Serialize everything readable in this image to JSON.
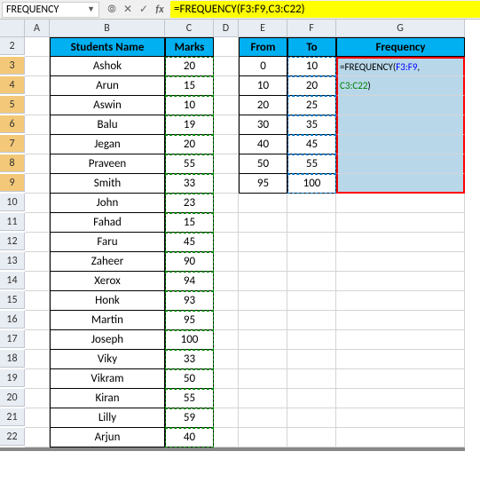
{
  "nameBox": "FREQUENCY",
  "formula": "=FREQUENCY(F3:F9,C3:C22)",
  "formulaParts": {
    "pre": "=FREQUENCY(",
    "r1": "F3:F9",
    "mid": ",",
    "r2": "C3:C22",
    "end": ")"
  },
  "cols": [
    "A",
    "B",
    "C",
    "D",
    "E",
    "F",
    "G"
  ],
  "rows": [
    "2",
    "3",
    "4",
    "5",
    "6",
    "7",
    "8",
    "9",
    "10",
    "11",
    "12",
    "13",
    "14",
    "15",
    "16",
    "17",
    "18",
    "19",
    "20",
    "21",
    "22"
  ],
  "h": {
    "b2": "Students Name",
    "c2": "Marks",
    "e2": "From",
    "f2": "To",
    "g2": "Frequency"
  },
  "students": [
    {
      "name": "Ashok",
      "marks": "20"
    },
    {
      "name": "Arun",
      "marks": "15"
    },
    {
      "name": "Aswin",
      "marks": "10"
    },
    {
      "name": "Balu",
      "marks": "19"
    },
    {
      "name": "Jegan",
      "marks": "20"
    },
    {
      "name": "Praveen",
      "marks": "55"
    },
    {
      "name": "Smith",
      "marks": "33"
    },
    {
      "name": "John",
      "marks": "23"
    },
    {
      "name": "Fahad",
      "marks": "15"
    },
    {
      "name": "Faru",
      "marks": "45"
    },
    {
      "name": "Zaheer",
      "marks": "90"
    },
    {
      "name": "Xerox",
      "marks": "94"
    },
    {
      "name": "Honk",
      "marks": "93"
    },
    {
      "name": "Martin",
      "marks": "95"
    },
    {
      "name": "Joseph",
      "marks": "100"
    },
    {
      "name": "Viky",
      "marks": "33"
    },
    {
      "name": "Vikram",
      "marks": "50"
    },
    {
      "name": "Kiran",
      "marks": "55"
    },
    {
      "name": "Lilly",
      "marks": "59"
    },
    {
      "name": "Arjun",
      "marks": "40"
    }
  ],
  "bins": [
    {
      "from": "0",
      "to": "10"
    },
    {
      "from": "10",
      "to": "20"
    },
    {
      "from": "20",
      "to": "25"
    },
    {
      "from": "30",
      "to": "35"
    },
    {
      "from": "40",
      "to": "45"
    },
    {
      "from": "50",
      "to": "55"
    },
    {
      "from": "95",
      "to": "100"
    }
  ]
}
